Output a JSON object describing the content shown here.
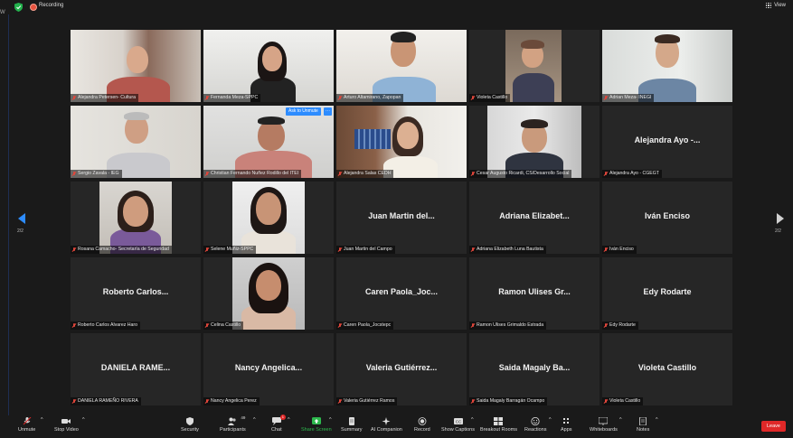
{
  "topbar": {
    "recording_label": "Recording",
    "view_label": "View",
    "edge_letter": "W"
  },
  "pager": {
    "left_count": "2/2",
    "right_count": "2/2"
  },
  "ask_to_unmute": {
    "label": "Ask to Unmute",
    "more": "···"
  },
  "participants": [
    {
      "name": "Alejandra Petersen- Cultura",
      "video": true
    },
    {
      "name": "Fernanda Meza-SPPC",
      "video": true
    },
    {
      "name": "Arturo Altamirano, Zapopan",
      "video": true
    },
    {
      "name": "Violeta Castillo",
      "video": true
    },
    {
      "name": "Adrian Meza- INEGI",
      "video": true
    },
    {
      "name": "Sergio Zavala - IEG",
      "video": true
    },
    {
      "name": "Christian Fernando Nuñez Rodillo del ITEI",
      "video": true
    },
    {
      "name": "Alejandra Salas CEDH",
      "video": true
    },
    {
      "name": "Cesar Augusto Ricardi, CS/Desarrollo Social",
      "video": true
    },
    {
      "name": "Alejandra Ayo - CGEGT",
      "video": false,
      "display": "Alejandra Ayo -..."
    },
    {
      "name": "Rosana Camacho- Secretaría de Seguridad",
      "video": true
    },
    {
      "name": "Selene Muñiz-SPPC",
      "video": true
    },
    {
      "name": "Juan Martin del Campo",
      "video": false,
      "display": "Juan Martin del..."
    },
    {
      "name": "Adriana Elizabeth Luna Bautista",
      "video": false,
      "display": "Adriana Elizabet..."
    },
    {
      "name": "Iván Enciso",
      "video": false,
      "display": "Iván Enciso"
    },
    {
      "name": "Roberto Carlos Alvarez Haro",
      "video": false,
      "display": "Roberto Carlos..."
    },
    {
      "name": "Celina Castillo",
      "video": true
    },
    {
      "name": "Caren Paola_Jocstepc",
      "video": false,
      "display": "Caren Paola_Joc..."
    },
    {
      "name": "Ramon Ulises Grimaldo Estrada",
      "video": false,
      "display": "Ramon Ulises Gr..."
    },
    {
      "name": "Edy Rodarte",
      "video": false,
      "display": "Edy Rodarte"
    },
    {
      "name": "DANIELA RAMEÑO RIVERA",
      "video": false,
      "display": "DANIELA RAME..."
    },
    {
      "name": "Nancy Angelica Perez",
      "video": false,
      "display": "Nancy Angelica..."
    },
    {
      "name": "Valeria Gutiérrez Ramos",
      "video": false,
      "display": "Valeria Gutiérrez..."
    },
    {
      "name": "Saida Magaly Barragán Ocampo",
      "video": false,
      "display": "Saida Magaly Ba..."
    },
    {
      "name": "Violeta Castillo",
      "video": false,
      "display": "Violeta Castillo"
    }
  ],
  "toolbar": {
    "unmute": "Unmute",
    "stop_video": "Stop Video",
    "security": "Security",
    "participants": "Participants",
    "participants_count": "49",
    "chat": "Chat",
    "chat_badge": "1",
    "share_screen": "Share Screen",
    "summary": "Summary",
    "ai_companion": "AI Companion",
    "record": "Record",
    "show_captions": "Show Captions",
    "breakout_rooms": "Breakout Rooms",
    "reactions": "Reactions",
    "apps": "Apps",
    "whiteboards": "Whiteboards",
    "notes": "Notes",
    "leave": "Leave"
  },
  "colors": {
    "accent": "#2d8cff",
    "leave": "#e02828",
    "share": "#2db94d",
    "muted_mic": "#e0463a"
  }
}
